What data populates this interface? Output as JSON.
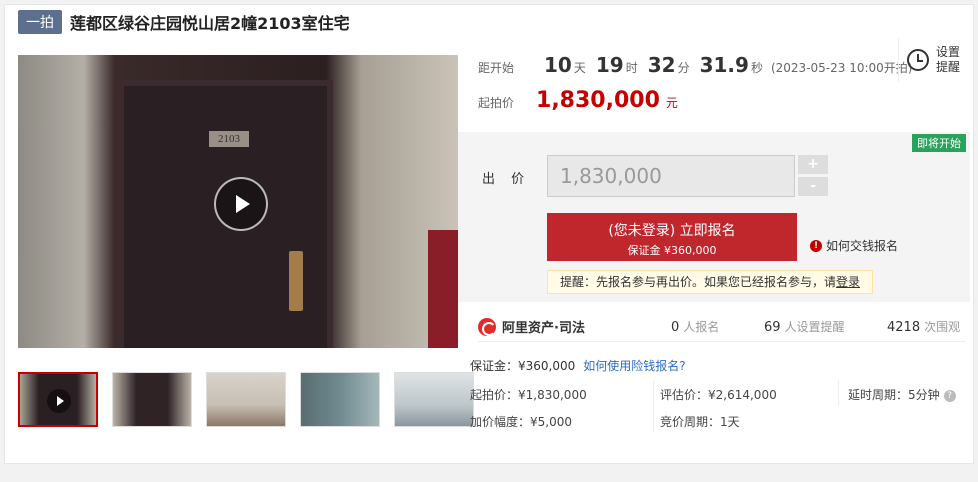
{
  "header": {
    "tag": "一拍",
    "title": "莲都区绿谷庄园悦山居2幢2103室住宅"
  },
  "media": {
    "door_number": "2103",
    "thumbnails": [
      "video",
      "door",
      "interior",
      "balcony",
      "garage"
    ]
  },
  "countdown": {
    "label": "距开始",
    "days": "10",
    "days_unit": "天",
    "hours": "19",
    "hours_unit": "时",
    "minutes": "32",
    "minutes_unit": "分",
    "seconds": "31.9",
    "seconds_unit": "秒",
    "start_note": "(2023-05-23 10:00开拍)"
  },
  "reminder": {
    "label": "设置提醒",
    "icon": "alarm-clock-icon"
  },
  "start_price": {
    "label": "起拍价",
    "value": "1,830,000",
    "unit": "元"
  },
  "bid": {
    "status_badge": "即将开始",
    "label": "出 价",
    "input_value": "1,830,000",
    "plus": "+",
    "minus": "-",
    "signup_main": "(您未登录) 立即报名",
    "signup_sub": "保证金 ¥360,000",
    "howto": "如何交钱报名",
    "notice_text": "提醒：先报名参与再出价。如果您已经报名参与，请",
    "notice_link": "登录"
  },
  "stats": {
    "brand": "阿里资产·司法",
    "signups": "0",
    "signups_label": "人报名",
    "reminders": "69",
    "reminders_label": "人设置提醒",
    "views": "4218",
    "views_label": "次围观"
  },
  "details": {
    "deposit": "保证金：¥360,000",
    "deposit_link": "如何使用险钱报名?",
    "start_price": "起拍价：¥1,830,000",
    "appraisal": "评估价：¥2,614,000",
    "delay": "延时周期：5分钟",
    "increment": "加价幅度：¥5,000",
    "cycle": "竞价周期：1天"
  },
  "colors": {
    "accent_red": "#c40000",
    "button_red": "#c0272d",
    "badge_green": "#27a35b",
    "tag_blue": "#5c6f91"
  }
}
